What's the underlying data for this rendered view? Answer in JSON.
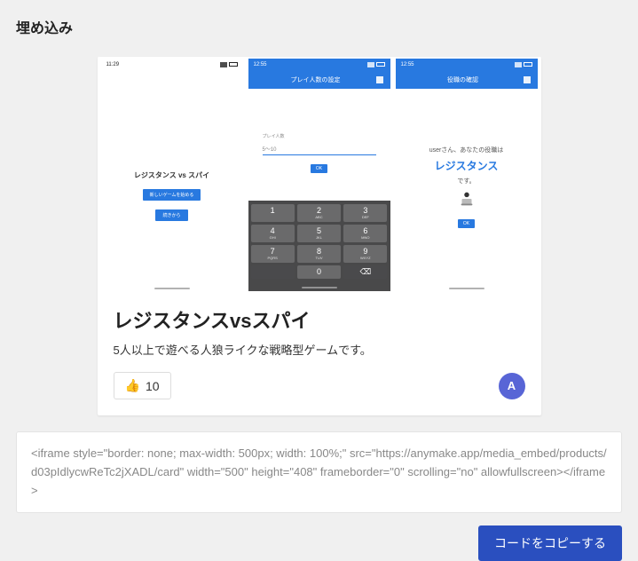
{
  "section_title": "埋め込み",
  "card": {
    "title": "レジスタンスvsスパイ",
    "description": "5人以上で遊べる人狼ライクな戦略型ゲームです。",
    "like_count": "10",
    "like_emoji": "👍",
    "avatar_letter": "A"
  },
  "screenshots": {
    "shot1": {
      "time": "11:29",
      "title": "レジスタンス vs スパイ",
      "btn1": "新しいゲームを始める",
      "btn2": "続きから"
    },
    "shot2": {
      "time": "12:55",
      "header": "プレイ人数の設定",
      "input_label": "プレイ人数",
      "input_hint": "5〜10",
      "ok": "OK",
      "keys": [
        "1",
        "2",
        "3",
        "4",
        "5",
        "6",
        "7",
        "8",
        "9",
        "",
        "0",
        ""
      ],
      "key_subs": [
        "",
        "ABC",
        "DEF",
        "GHI",
        "JKL",
        "MNO",
        "PQRS",
        "TUV",
        "WXYZ",
        "",
        "",
        ""
      ]
    },
    "shot3": {
      "time": "12:55",
      "header": "役職の確認",
      "line1": "userさん、あなたの役職は",
      "role": "レジスタンス",
      "desc": "です。",
      "ok": "OK"
    }
  },
  "embed_code": "<iframe style=\"border: none; max-width: 500px; width: 100%;\" src=\"https://anymake.app/media_embed/products/d03pIdlycwReTc2jXADL/card\" width=\"500\" height=\"408\" frameborder=\"0\" scrolling=\"no\" allowfullscreen></iframe>",
  "copy_button": "コードをコピーする"
}
